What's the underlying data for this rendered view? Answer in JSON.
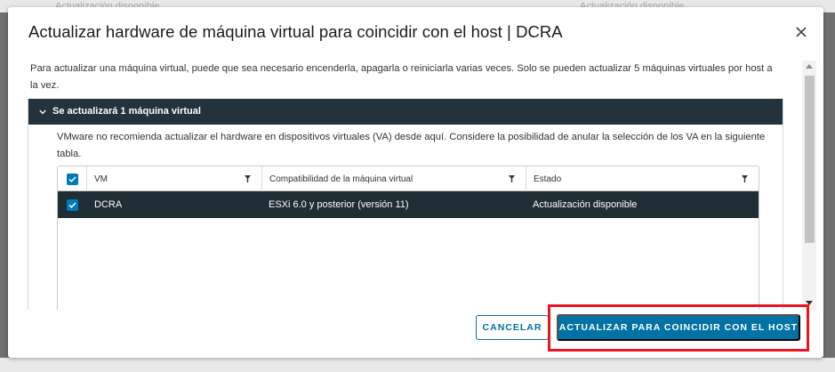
{
  "background": {
    "left_text": "Actualización disponible",
    "right_text": "Actualización disponible"
  },
  "dialog": {
    "title": "Actualizar hardware de máquina virtual para coincidir con el host | DCRA",
    "close_icon": "close-icon",
    "intro": "Para actualizar una máquina virtual, puede que sea necesario encenderla, apagarla o reiniciarla varias veces. Solo se pueden actualizar 5 máquinas virtuales por host a la vez.",
    "section": {
      "header": "Se actualizará 1 máquina virtual",
      "expanded": true,
      "warning": "VMware no recomienda actualizar el hardware en dispositivos virtuales (VA) desde aquí. Considere la posibilidad de anular la selección de los VA en la siguiente tabla."
    },
    "grid": {
      "columns": [
        "VM",
        "Compatibilidad de la máquina virtual",
        "Estado"
      ],
      "rows": [
        {
          "selected": true,
          "vm": "DCRA",
          "compatibility": "ESXi 6.0 y posterior (versión 11)",
          "state": "Actualización disponible"
        }
      ]
    },
    "buttons": {
      "cancel": "CANCELAR",
      "primary": "ACTUALIZAR PARA COINCIDIR CON EL HOST"
    },
    "colors": {
      "accent": "#0072a3",
      "selected_row": "#1f2e35",
      "section_header": "#22333b",
      "highlight_box": "#e8161e"
    }
  }
}
